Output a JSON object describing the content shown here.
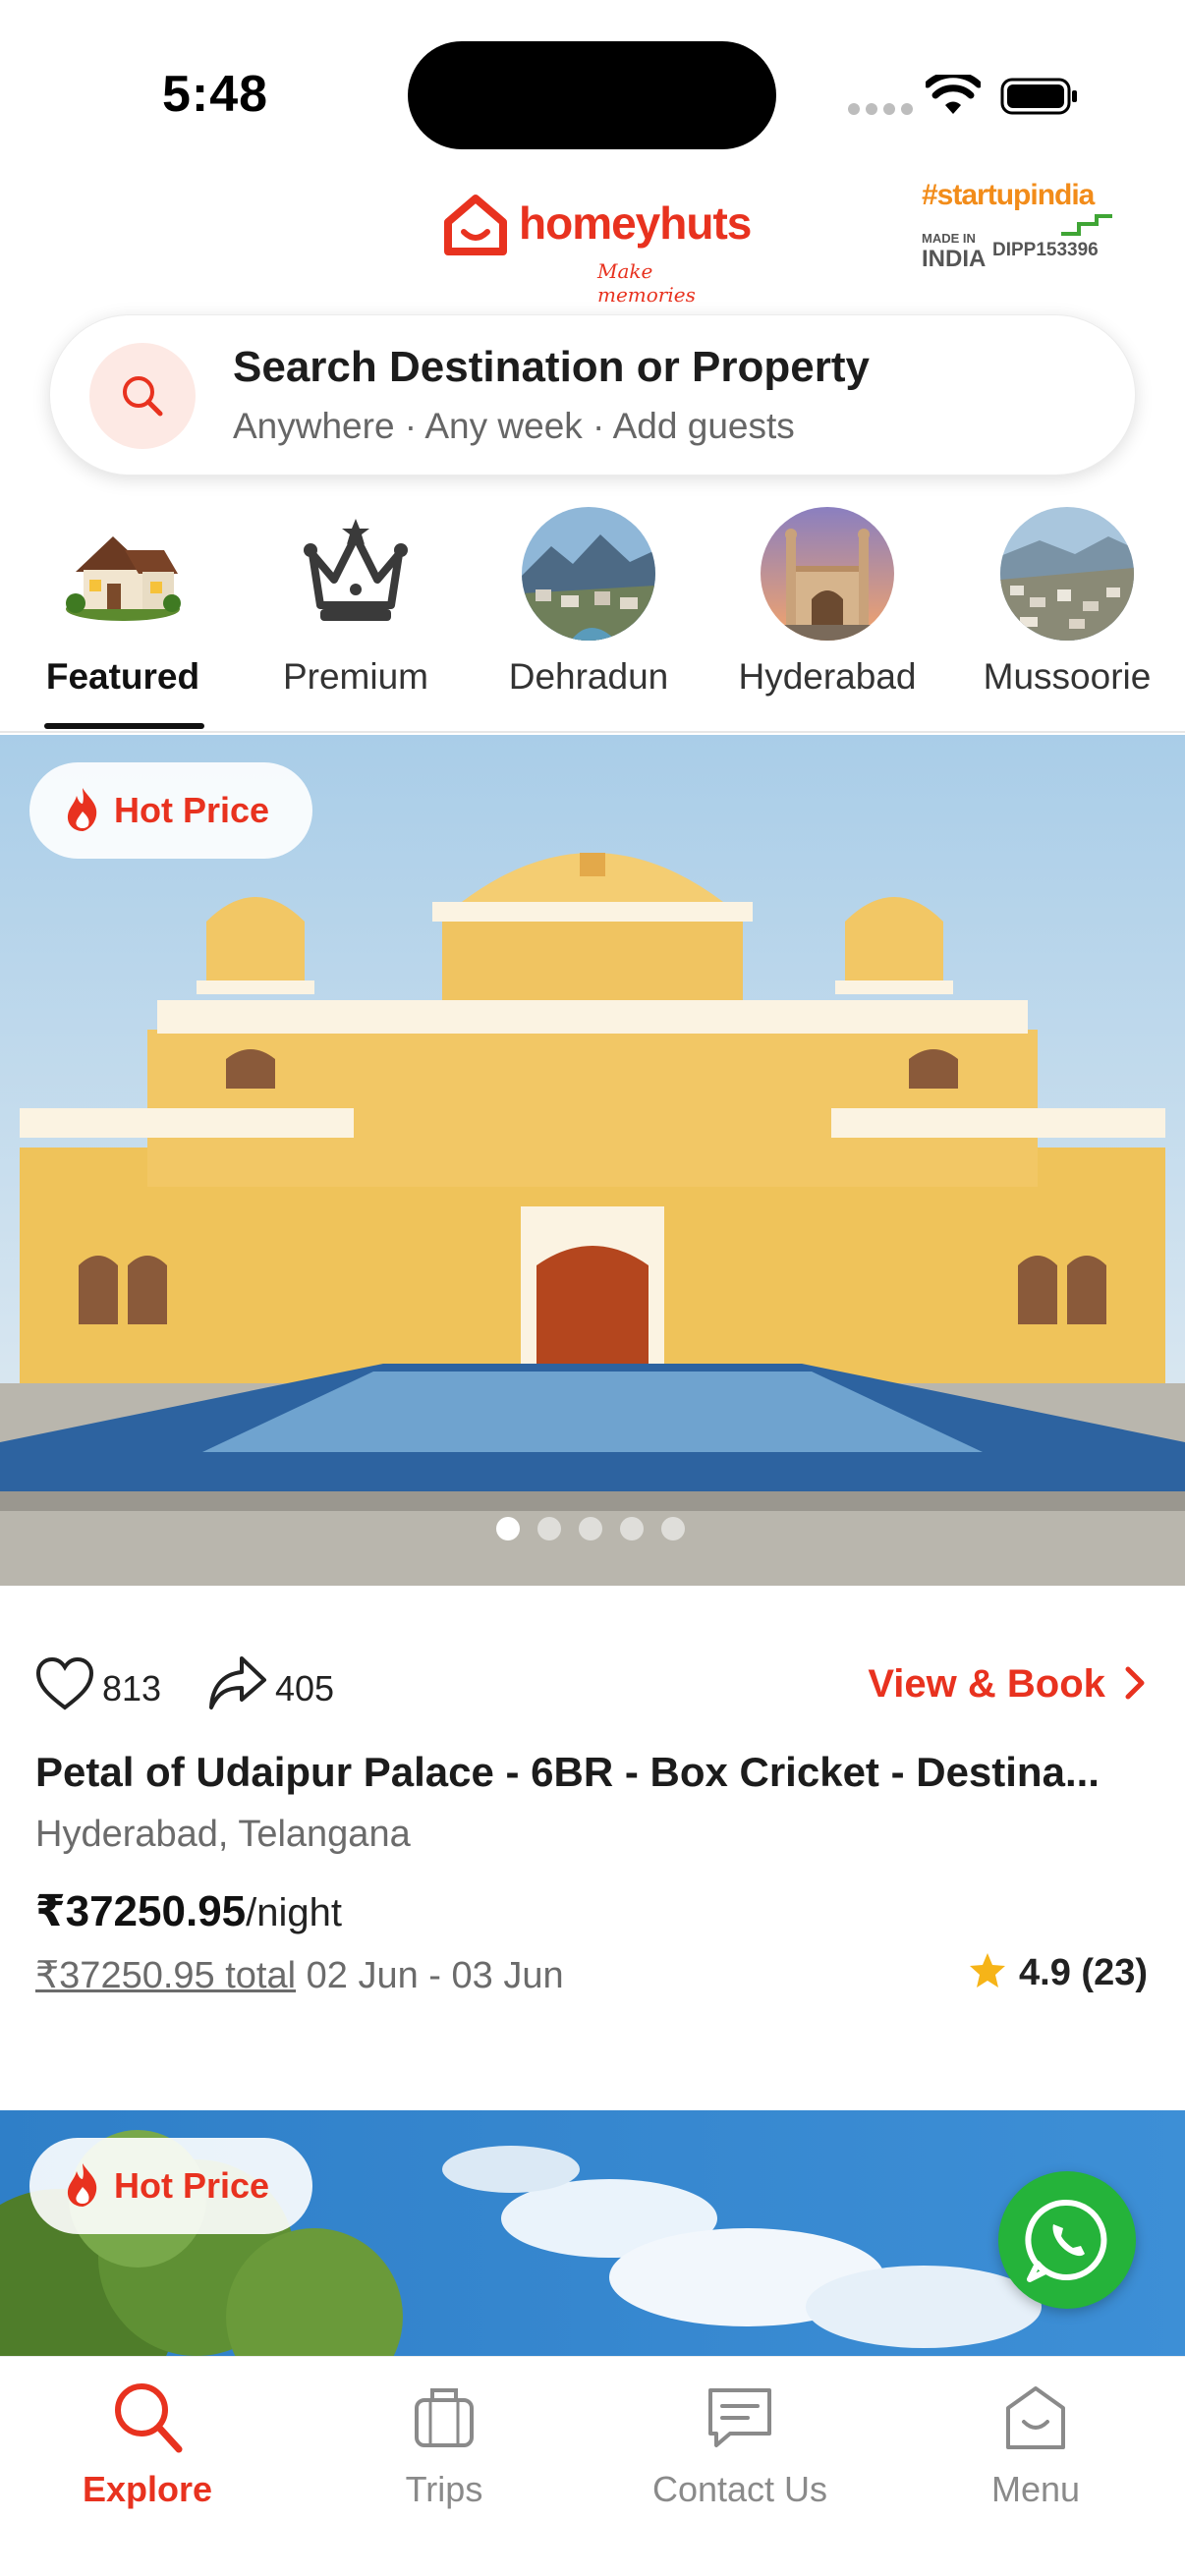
{
  "status_bar": {
    "time": "5:48"
  },
  "header": {
    "logo_name": "homeyhuts",
    "logo_tagline": "Make memories",
    "badge_tag": "#startupindia",
    "badge_made": "MADE IN",
    "badge_india": "INDIA",
    "badge_dipp": "DIPP153396"
  },
  "search": {
    "title": "Search Destination or Property",
    "subtitle": "Anywhere · Any week · Add guests",
    "icon": "search-icon"
  },
  "categories": [
    {
      "label": "Featured",
      "active": true
    },
    {
      "label": "Premium",
      "active": false
    },
    {
      "label": "Dehradun",
      "active": false
    },
    {
      "label": "Hyderabad",
      "active": false
    },
    {
      "label": "Mussoorie",
      "active": false
    }
  ],
  "listing": {
    "badge": "Hot Price",
    "image_count": 5,
    "current_image": 1,
    "likes": "813",
    "shares": "405",
    "cta": "View & Book",
    "title": "Petal of Udaipur Palace - 6BR - Box Cricket - Destina...",
    "location": "Hyderabad, Telangana",
    "price": "₹37250.95",
    "price_unit": "/night",
    "total": "₹37250.95 total",
    "dates": "02 Jun - 03 Jun",
    "rating": "4.9 (23)"
  },
  "listing2": {
    "badge": "Hot Price"
  },
  "nav": [
    {
      "label": "Explore",
      "icon": "search-icon",
      "active": true
    },
    {
      "label": "Trips",
      "icon": "suitcase-icon",
      "active": false
    },
    {
      "label": "Contact Us",
      "icon": "chat-icon",
      "active": false
    },
    {
      "label": "Menu",
      "icon": "menu-smile-icon",
      "active": false
    }
  ],
  "colors": {
    "brand": "#e8321f",
    "whatsapp": "#25b33a",
    "startup_orange": "#f28c1a"
  }
}
